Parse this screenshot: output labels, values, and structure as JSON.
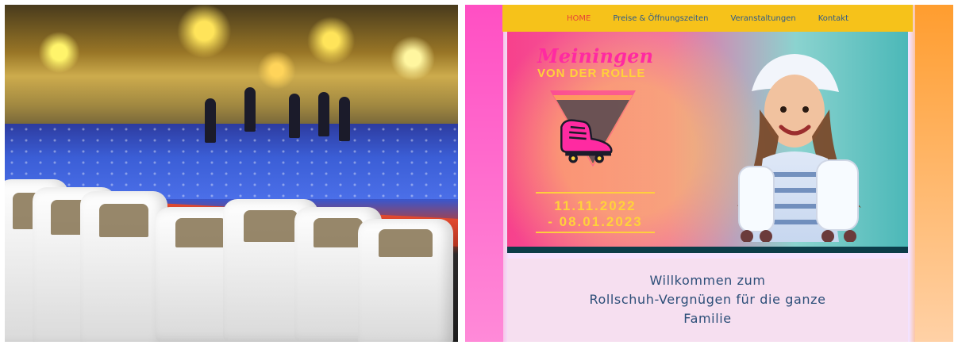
{
  "nav": {
    "items": [
      {
        "label": "HOME",
        "active": true
      },
      {
        "label": "Preise & Öffnungszeiten",
        "active": false
      },
      {
        "label": "Veranstaltungen",
        "active": false
      },
      {
        "label": "Kontakt",
        "active": false
      }
    ],
    "colors": {
      "bar": "#f6c21a",
      "link": "#2d5a8c",
      "active": "#e5453a"
    }
  },
  "hero": {
    "brand_line1": "Meiningen",
    "brand_line2": "VON DER ROLLE",
    "date_line1": "11.11.2022",
    "date_line2": "- 08.01.2023",
    "colors": {
      "pink": "#ff2aa1",
      "yellow": "#ffd23a",
      "teal": "#4bb8b8",
      "deep": "#0b3d4a"
    }
  },
  "welcome": {
    "line1": "Willkommen zum",
    "line2": "Rollschuh-Vergnügen für die ganze",
    "line3": "Familie"
  }
}
